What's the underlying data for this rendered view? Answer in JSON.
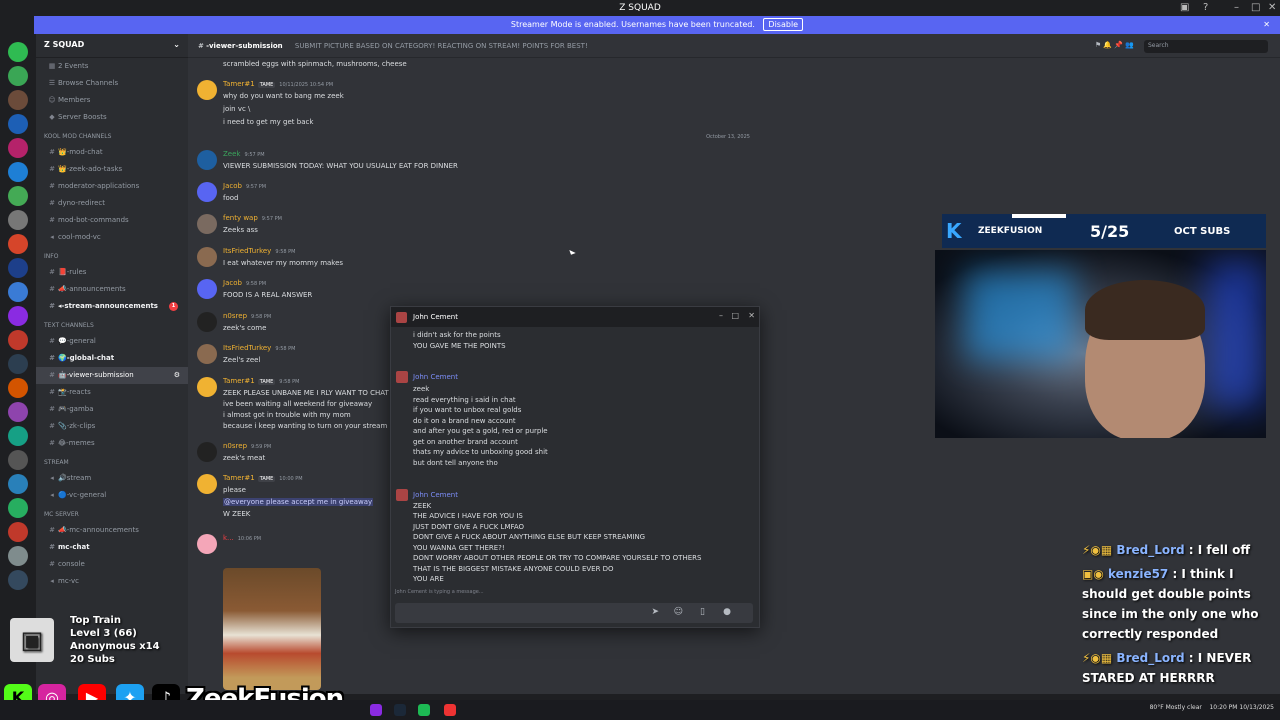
{
  "window": {
    "title": "Z SQUAD"
  },
  "banner": {
    "text": "Streamer Mode is enabled. Usernames have been truncated.",
    "disable_label": "Disable"
  },
  "sidebar": {
    "guild_name": "Z SQUAD",
    "top_items": [
      "2 Events",
      "Browse Channels",
      "Members",
      "Server Boosts"
    ],
    "categories": [
      {
        "name": "Kool mod channels",
        "items": [
          "👑-mod-chat",
          "👑-zeek-ado-tasks",
          "moderator-applications",
          "dyno-redirect",
          "mod-bot-commands",
          "cool-mod-vc"
        ]
      },
      {
        "name": "Info",
        "items": [
          "📕-rules",
          "📣-announcements",
          "◂-stream-announcements"
        ]
      },
      {
        "name": "Text Channels",
        "items": [
          "💬-general",
          "🌍-global-chat",
          "🤖-viewer-submission",
          "📸-reacts",
          "🎮-gamba",
          "📎-zk-clips",
          "😂-memes"
        ]
      },
      {
        "name": "STREAM",
        "items": [
          "🔊stream",
          "🔵-vc-general"
        ]
      },
      {
        "name": "MC SERVER",
        "items": [
          "📣-mc-announcements",
          "mc-chat",
          "console",
          "mc-vc"
        ]
      }
    ],
    "notif_badge": "1"
  },
  "channel": {
    "name": "-viewer-submission",
    "topic": "SUBMIT PICTURE BASED ON CATEGORY! REACTING ON STREAM! POINTS FOR BEST!",
    "search_placeholder": "Search"
  },
  "messages": {
    "top_line": "scrambled eggs with spinmach, mushrooms, cheese",
    "date_divider": "October 13, 2025",
    "list": [
      {
        "user": "Tamer#1",
        "tag": "TAME",
        "time": "10/11/2025 10:54 PM",
        "lines": [
          "why do you want to bang me zeek",
          "join vc \\",
          "i need to get my get back"
        ]
      },
      {
        "user": "Zeek",
        "time": "9:57 PM",
        "lines": [
          "VIEWER SUBMISSION TODAY: WHAT YOU USUALLY EAT FOR DINNER"
        ]
      },
      {
        "user": "Jacob",
        "time": "9:57 PM",
        "lines": [
          "food"
        ]
      },
      {
        "user": "fenty wap",
        "time": "9:57 PM",
        "lines": [
          "Zeeks ass"
        ]
      },
      {
        "user": "ItsFriedTurkey",
        "time": "9:58 PM",
        "lines": [
          "I eat whatever my mommy makes"
        ]
      },
      {
        "user": "Jacob",
        "time": "9:58 PM",
        "lines": [
          "FOOD IS A REAL ANSWER"
        ]
      },
      {
        "user": "n0srep",
        "time": "9:58 PM",
        "lines": [
          "zeek's come"
        ]
      },
      {
        "user": "ItsFriedTurkey",
        "time": "9:58 PM",
        "lines": [
          "Zeel's zeel"
        ]
      },
      {
        "user": "Tamer#1",
        "tag": "TAME",
        "time": "9:58 PM",
        "lines": [
          "ZEEK PLEASE UNBANE ME I RLY WANT TO CHAT",
          "ive been waiting all weekend for giveaway",
          "i almost got in trouble with my mom",
          "because i keep wanting to turn on your stream"
        ]
      },
      {
        "user": "n0srep",
        "time": "9:59 PM",
        "lines": [
          "zeek's meat"
        ]
      },
      {
        "user": "Tamer#1",
        "tag": "TAME",
        "time": "10:00 PM",
        "lines": [
          "please",
          "@everyone please accept me in giveaway",
          "W ZEEK"
        ]
      },
      {
        "user": "k...",
        "time": "10:06 PM",
        "lines": []
      }
    ]
  },
  "popup": {
    "title": "John Cement",
    "pre_lines": [
      "i didn't ask for the points",
      "YOU GAVE ME THE POINTS"
    ],
    "msg1_user": "John Cement",
    "msg1": [
      "zeek",
      "read everything i said in chat",
      "if you want to unbox real golds",
      "do it on a brand new account",
      "and after you get a gold, red or purple",
      "get on another brand account",
      "thats my advice to unboxing good shit",
      "but dont tell anyone tho"
    ],
    "msg2_user": "John Cement",
    "msg2": [
      "ZEEK",
      "THE ADVICE I HAVE FOR YOU IS",
      "JUST DONT GIVE A FUCK LMFAO",
      "DONT GIVE A FUCK ABOUT ANYTHING ELSE BUT KEEP STREAMING",
      "YOU WANNA GET THERE?!",
      "DONT WORRY ABOUT OTHER PEOPLE OR TRY TO COMPARE YOURSELF TO OTHERS",
      "THAT IS THE BIGGEST MISTAKE ANYONE COULD EVER DO",
      "YOU ARE"
    ],
    "typing": "John Cement is typing a message..."
  },
  "overlay": {
    "brand": "ZEEKFUSION",
    "sub_count": "5/25",
    "sub_label": "OCT SUBS",
    "chat": [
      {
        "user": "Bred_Lord",
        "text": " : I fell off"
      },
      {
        "user": "kenzie57",
        "text": " : I think I should get double points since im the only one who correctly responded"
      },
      {
        "user": "Bred_Lord",
        "text": " : I NEVER STARED AT HERRRR"
      }
    ],
    "train": {
      "title": "Top Train",
      "level": "Level 3 (66)",
      "anon": "Anonymous x14",
      "subs": "20 Subs"
    },
    "name": "ZeekFusion"
  },
  "taskbar": {
    "weather": "80°F  Mostly clear",
    "time": "10:20 PM",
    "date": "10/13/2025"
  }
}
